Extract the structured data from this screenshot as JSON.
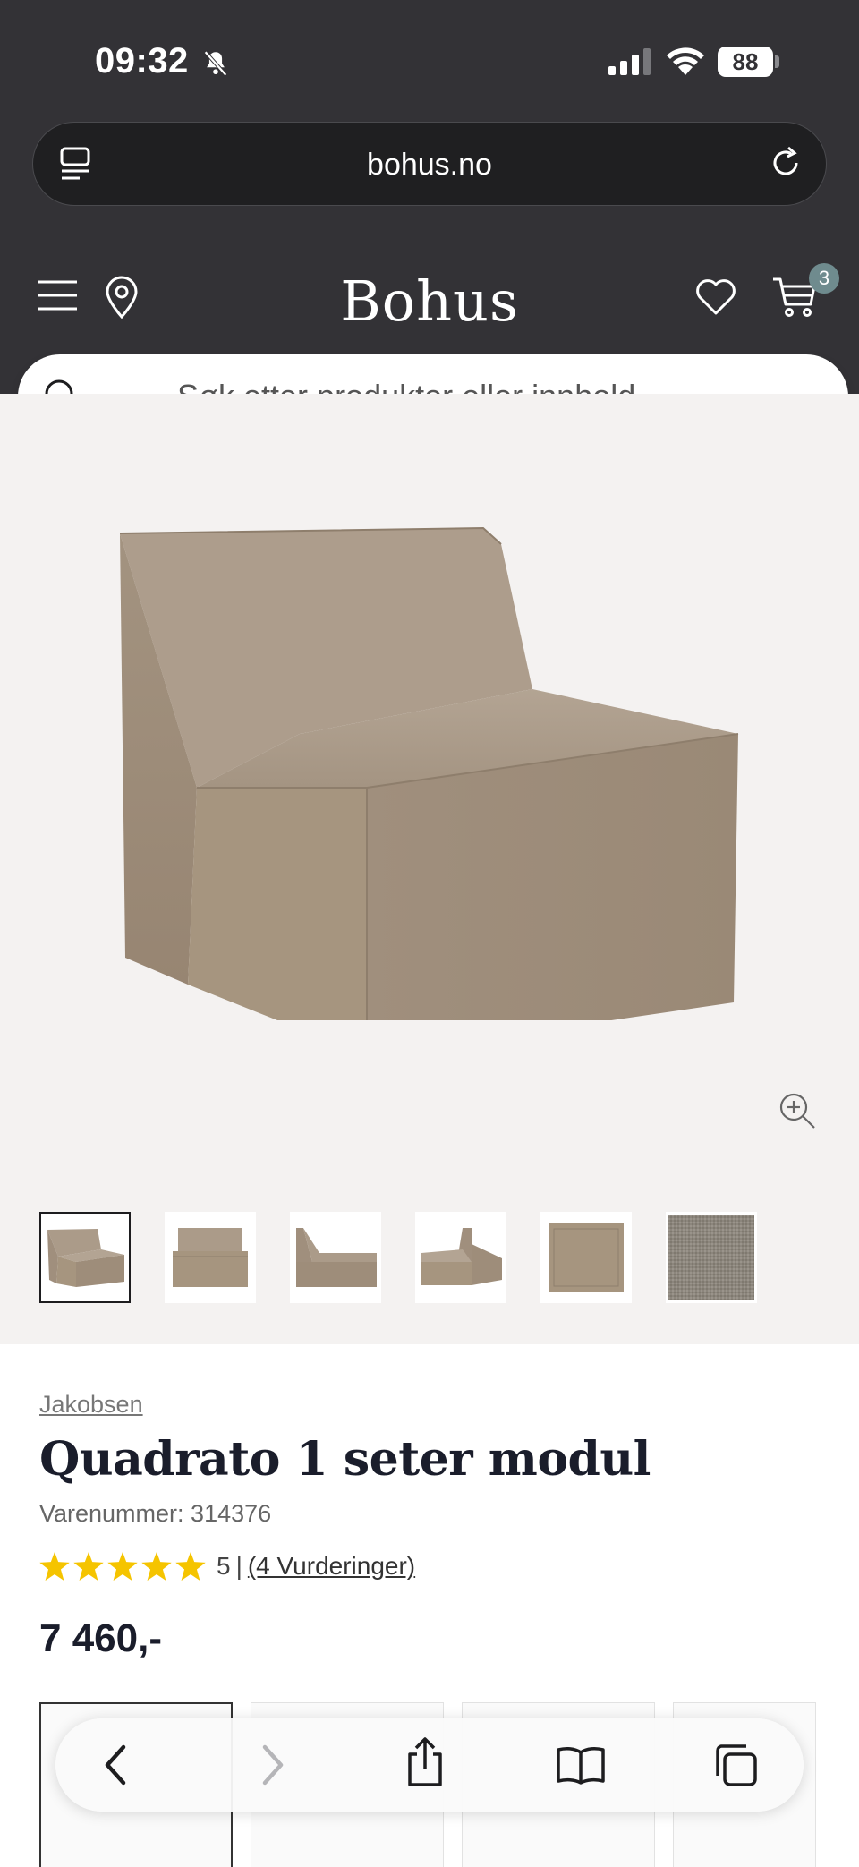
{
  "status_bar": {
    "time": "09:32",
    "battery": "88"
  },
  "browser": {
    "url": "bohus.no"
  },
  "site": {
    "logo": "Bohus",
    "cart_count": "3",
    "search_placeholder": "Søk etter produkter eller innhold ..."
  },
  "gallery": {
    "thumbnail_count": 6,
    "active_thumbnail": 0
  },
  "product": {
    "brand": "Jakobsen",
    "title": "Quadrato 1 seter modul",
    "sku": "Varenummer: 314376",
    "rating_value": "5",
    "rating_separator": "|",
    "rating_link": "(4 Vurderinger)",
    "stars": 5,
    "price": "7 460,-"
  },
  "colors": {
    "header_bg": "#333236",
    "gallery_bg": "#f4f2f1",
    "star": "#f5c400",
    "cart_badge": "#6f8b8e",
    "sofa_fabric": "#a69685"
  }
}
